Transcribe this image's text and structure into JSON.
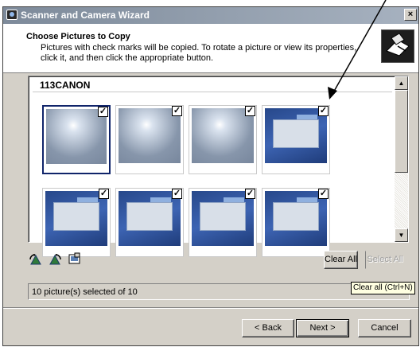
{
  "window": {
    "title": "Scanner and Camera Wizard",
    "close_glyph": "×"
  },
  "header": {
    "title": "Choose Pictures to Copy",
    "description": "Pictures with check marks will be copied. To rotate a picture or view its properties, click it, and then click the appropriate button."
  },
  "gallery": {
    "folder": "113CANON",
    "check_glyph": "✓",
    "items": [
      {
        "checked": true,
        "selected": true,
        "style": "light"
      },
      {
        "checked": true,
        "selected": false,
        "style": "light"
      },
      {
        "checked": true,
        "selected": false,
        "style": "light"
      },
      {
        "checked": true,
        "selected": false,
        "style": "blue"
      },
      {
        "checked": true,
        "selected": false,
        "style": "blue"
      },
      {
        "checked": true,
        "selected": false,
        "style": "blue"
      },
      {
        "checked": true,
        "selected": false,
        "style": "blue"
      },
      {
        "checked": true,
        "selected": false,
        "style": "blue"
      }
    ]
  },
  "toolbar": {
    "rotate_left_icon": "rotate-left-icon",
    "rotate_right_icon": "rotate-right-icon",
    "properties_icon": "properties-icon",
    "clear_all": "Clear All",
    "select_all": "Select All"
  },
  "status": {
    "text": "10 picture(s) selected of 10"
  },
  "tooltip": {
    "text": "Clear all (Ctrl+N)"
  },
  "footer": {
    "back": "< Back",
    "next": "Next >",
    "cancel": "Cancel"
  },
  "colors": {
    "dialog_face": "#d4d0c8",
    "titlebar_inactive": "#7d8a9a",
    "selection_border": "#10246a",
    "tooltip_bg": "#ffffe1"
  }
}
